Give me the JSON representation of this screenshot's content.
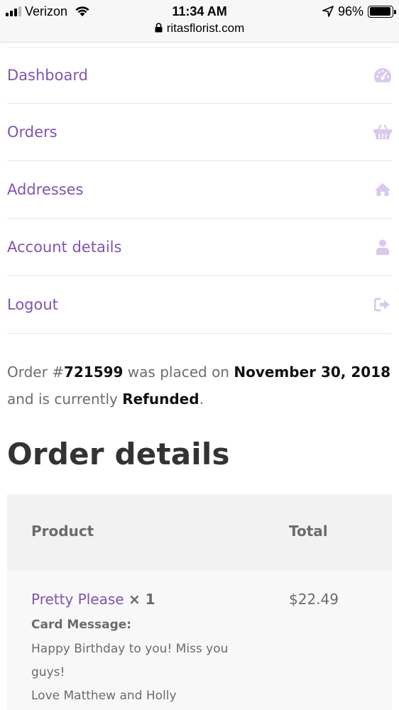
{
  "status_bar": {
    "carrier": "Verizon",
    "time": "11:34 AM",
    "battery": "96%",
    "battery_level": 0.96
  },
  "browser": {
    "url": "ritasflorist.com"
  },
  "nav": {
    "items": [
      {
        "label": "Dashboard",
        "icon": "dashboard-icon"
      },
      {
        "label": "Orders",
        "icon": "basket-icon"
      },
      {
        "label": "Addresses",
        "icon": "home-icon"
      },
      {
        "label": "Account details",
        "icon": "user-icon"
      },
      {
        "label": "Logout",
        "icon": "logout-icon"
      }
    ],
    "icon_color": "#d9c9ee",
    "link_color": "#7f54b3"
  },
  "order": {
    "prefix": "Order #",
    "number": "721599",
    "placed_text": " was placed on ",
    "date": "November 30, 2018",
    "and_text": " and is currently ",
    "status": "Refunded",
    "end": "."
  },
  "details": {
    "heading": "Order details",
    "columns": {
      "product": "Product",
      "total": "Total"
    },
    "items": [
      {
        "name": "Pretty Please",
        "qty": "× 1",
        "total": "$22.49",
        "meta_label": "Card Message:",
        "meta_lines": [
          "Happy Birthday to you! Miss you",
          "guys!",
          "Love Matthew and Holly"
        ]
      }
    ]
  }
}
